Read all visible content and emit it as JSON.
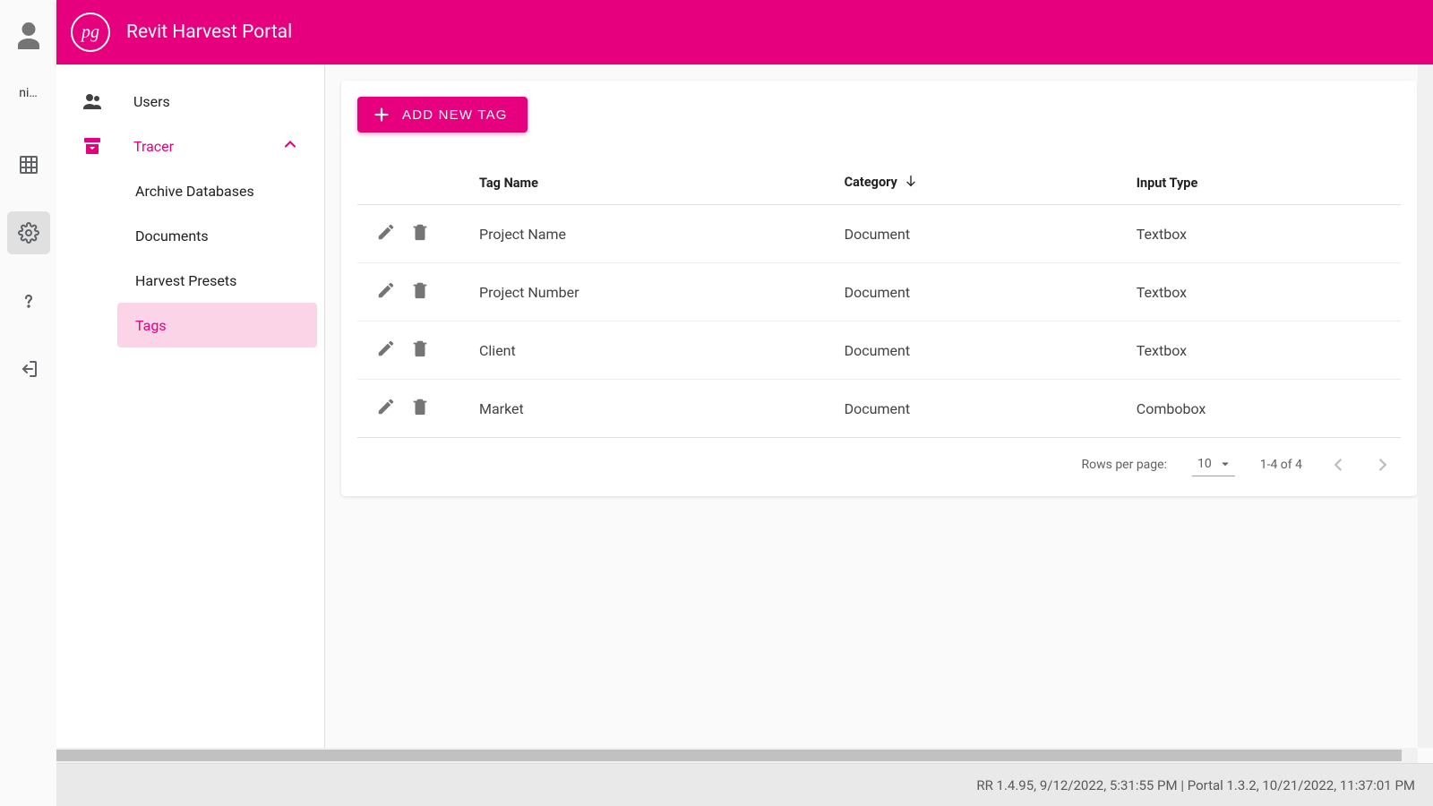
{
  "app": {
    "title": "Revit Harvest Portal",
    "logo_text": "pg"
  },
  "rail": {
    "user_short": "ni…"
  },
  "sidebar": {
    "items": [
      {
        "label": "Users"
      },
      {
        "label": "Tracer",
        "active": true,
        "expanded": true,
        "children": [
          {
            "label": "Archive Databases"
          },
          {
            "label": "Documents"
          },
          {
            "label": "Harvest Presets"
          },
          {
            "label": "Tags",
            "selected": true
          }
        ]
      }
    ]
  },
  "toolbar": {
    "add_label": "ADD NEW TAG"
  },
  "table": {
    "columns": {
      "tag_name": "Tag Name",
      "category": "Category",
      "input_type": "Input Type"
    },
    "sort_column": "category",
    "sort_dir": "asc",
    "rows": [
      {
        "tag_name": "Project Name",
        "category": "Document",
        "input_type": "Textbox"
      },
      {
        "tag_name": "Project Number",
        "category": "Document",
        "input_type": "Textbox"
      },
      {
        "tag_name": "Client",
        "category": "Document",
        "input_type": "Textbox"
      },
      {
        "tag_name": "Market",
        "category": "Document",
        "input_type": "Combobox"
      }
    ]
  },
  "pagination": {
    "label": "Rows per page:",
    "page_size": "10",
    "range": "1-4 of 4"
  },
  "footer": {
    "version": "RR 1.4.95, 9/12/2022, 5:31:55 PM | Portal 1.3.2, 10/21/2022, 11:37:01 PM"
  }
}
